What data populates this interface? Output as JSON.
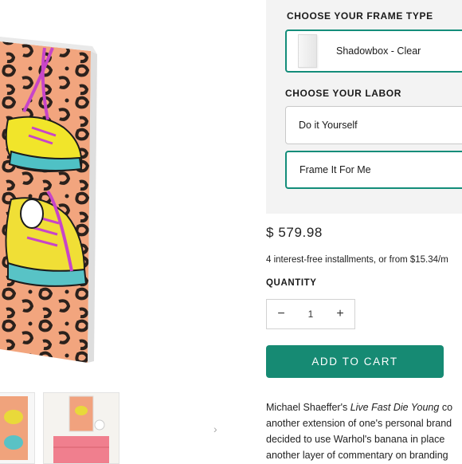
{
  "frame_section": {
    "title": "CHOOSE YOUR FRAME TYPE",
    "selected_option": "Shadowbox - Clear"
  },
  "labor_section": {
    "title": "CHOOSE YOUR LABOR",
    "options": [
      {
        "label": "Do it Yourself",
        "selected": false
      },
      {
        "label": "Frame It For Me",
        "selected": true
      }
    ]
  },
  "price": "$ 579.98",
  "installments_text": "4 interest-free installments, or from $15.34/m",
  "quantity": {
    "label": "QUANTITY",
    "value": "1",
    "decrement_symbol": "−",
    "increment_symbol": "+"
  },
  "add_to_cart_label": "ADD TO CART",
  "description": {
    "line1_prefix": "Michael Shaeffer's ",
    "line1_title": "Live Fast Die Young",
    "line1_suffix": " co",
    "line2": "another extension of one's personal brand",
    "line3": "decided to use Warhol's banana in place",
    "line4": "another layer of commentary on branding"
  },
  "gallery": {
    "next_arrow_icon": "chevron-right-icon"
  },
  "colors": {
    "accent": "#168a73",
    "selected_border": "#138d7a",
    "panel_bg": "#f3f3f3"
  }
}
